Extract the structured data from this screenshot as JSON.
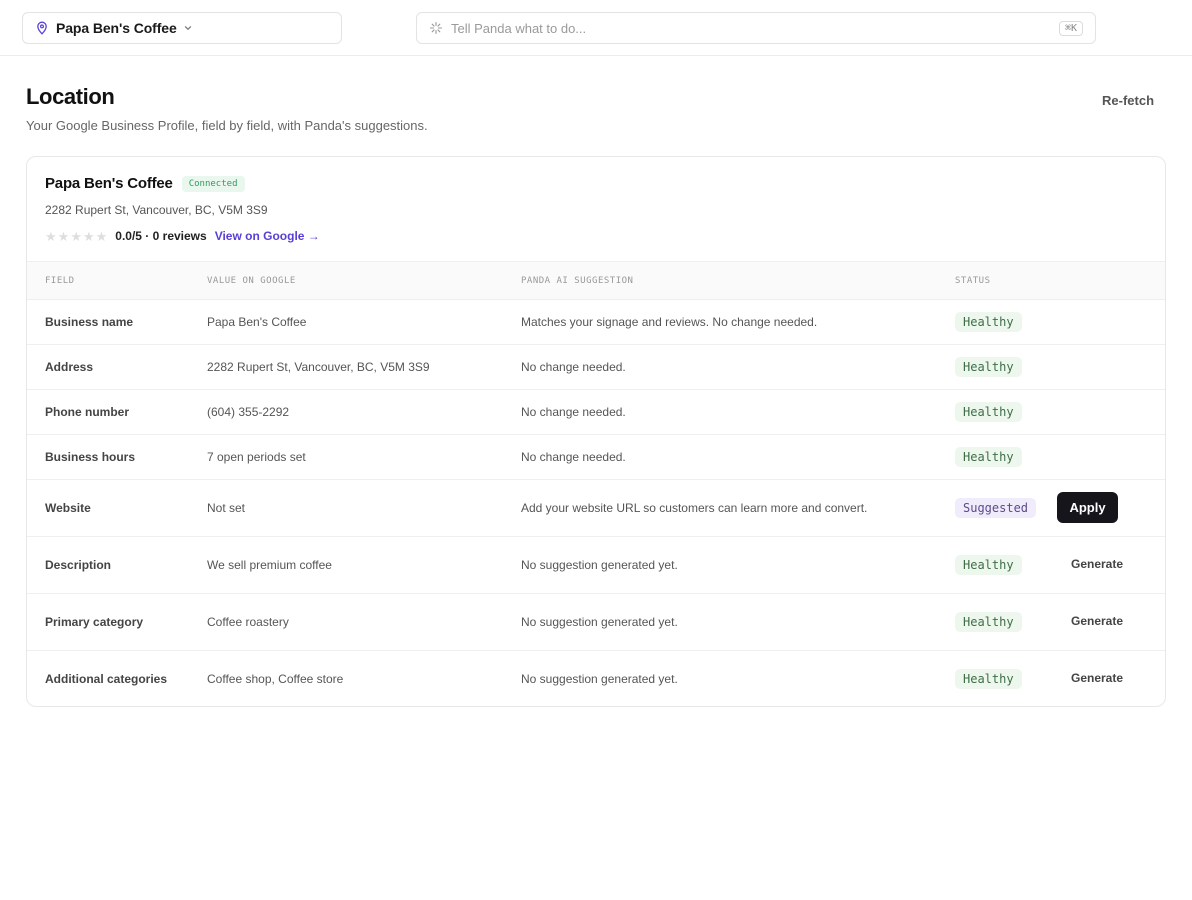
{
  "topbar": {
    "location_name": "Papa Ben's Coffee",
    "command_placeholder": "Tell Panda what to do...",
    "shortcut": "⌘K",
    "icons": [
      "map-pin-icon",
      "chevron-down-icon",
      "sparkles-icon"
    ]
  },
  "header": {
    "title": "Location",
    "subtitle": "Your Google Business Profile, field by field, with Panda's suggestions.",
    "refetch_label": "Re-fetch"
  },
  "business": {
    "name": "Papa Ben's Coffee",
    "connection_status": "Connected",
    "address": "2282 Rupert St, Vancouver, BC, V5M 3S9",
    "stars_filled": 0,
    "stars_total": 5,
    "rating_text": "0.0/5 · 0 reviews",
    "view_link": "View on Google →"
  },
  "table": {
    "columns": [
      "FIELD",
      "VALUE ON GOOGLE",
      "PANDA AI SUGGESTION",
      "STATUS"
    ],
    "rows": [
      {
        "field": "Business name",
        "value": "Papa Ben's Coffee",
        "suggestion": "Matches your signage and reviews. No change needed.",
        "status": "Healthy",
        "action": ""
      },
      {
        "field": "Address",
        "value": "2282 Rupert St, Vancouver, BC, V5M 3S9",
        "suggestion": "No change needed.",
        "status": "Healthy",
        "action": ""
      },
      {
        "field": "Phone number",
        "value": "(604) 355-2292",
        "suggestion": "No change needed.",
        "status": "Healthy",
        "action": ""
      },
      {
        "field": "Business hours",
        "value": "7 open periods set",
        "suggestion": "No change needed.",
        "status": "Healthy",
        "action": ""
      },
      {
        "field": "Website",
        "value": "Not set",
        "suggestion": "Add your website URL so customers can learn more and convert.",
        "status": "Suggested",
        "action": "Apply"
      },
      {
        "field": "Description",
        "value": "We sell premium coffee",
        "suggestion": "No suggestion generated yet.",
        "status": "Healthy",
        "action": "Generate"
      },
      {
        "field": "Primary category",
        "value": "Coffee roastery",
        "suggestion": "No suggestion generated yet.",
        "status": "Healthy",
        "action": "Generate"
      },
      {
        "field": "Additional categories",
        "value": "Coffee shop, Coffee store",
        "suggestion": "No suggestion generated yet.",
        "status": "Healthy",
        "action": "Generate"
      }
    ]
  },
  "colors": {
    "accent": "#5a3fd6",
    "connected_bg": "#e9f7ee",
    "connected_text": "#2f9e5c",
    "healthy_bg": "#eef7ee",
    "healthy_text": "#3d6e46",
    "suggested_bg": "#f0ecfb",
    "suggested_text": "#5b4a8a",
    "apply_bg": "#15151b"
  }
}
